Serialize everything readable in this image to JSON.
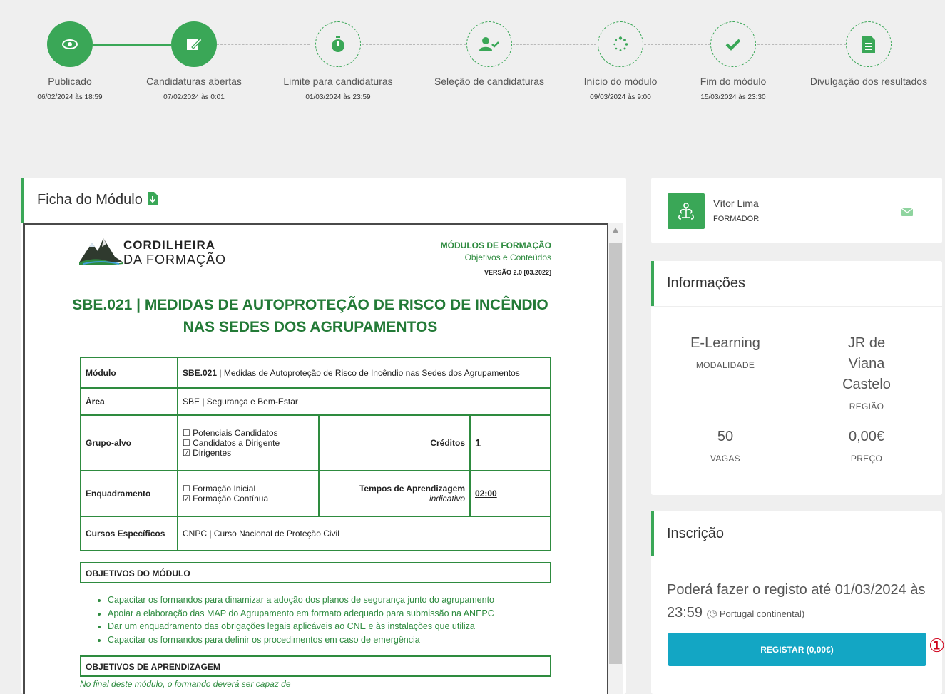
{
  "timeline": {
    "steps": [
      {
        "label": "Publicado",
        "date": "06/02/2024 às 18:59",
        "icon": "eye-icon",
        "state": "done"
      },
      {
        "label": "Candidaturas abertas",
        "date": "07/02/2024 às 0:01",
        "icon": "edit-form-icon",
        "state": "done"
      },
      {
        "label": "Limite para candidaturas",
        "date": "01/03/2024 às 23:59",
        "icon": "stopwatch-icon",
        "state": "todo"
      },
      {
        "label": "Seleção de candidaturas",
        "date": "",
        "icon": "user-check-icon",
        "state": "todo"
      },
      {
        "label": "Início do módulo",
        "date": "09/03/2024 às 9:00",
        "icon": "spinner-icon",
        "state": "todo"
      },
      {
        "label": "Fim do módulo",
        "date": "15/03/2024 às 23:30",
        "icon": "check-icon",
        "state": "todo"
      },
      {
        "label": "Divulgação dos resultados",
        "date": "",
        "icon": "document-icon",
        "state": "todo"
      }
    ]
  },
  "ficha": {
    "title": "Ficha do Módulo",
    "icon": "download-pdf-icon",
    "doc": {
      "logo_line1": "CORDILHEIRA",
      "logo_line2": "DA FORMAÇÃO",
      "header_1": "MÓDULOS DE FORMAÇÃO",
      "header_2": "Objetivos e Conteúdos",
      "version": "VERSÃO 2.0 [03.2022]",
      "title_line1": "SBE.021 | MEDIDAS DE AUTOPROTEÇÃO DE RISCO DE INCÊNDIO",
      "title_line2": "NAS SEDES DOS AGRUPAMENTOS",
      "rows": {
        "modulo_key": "Módulo",
        "modulo_code": "SBE.021",
        "modulo_val": " | Medidas de Autoproteção de Risco de Incêndio nas Sedes dos Agrupamentos",
        "area_key": "Área",
        "area_val": "SBE | Segurança e Bem-Estar",
        "grupo_key": "Grupo-alvo",
        "grupo_opts": [
          "☐ Potenciais Candidatos",
          "☐ Candidatos a Dirigente",
          "☑ Dirigentes"
        ],
        "creditos_key": "Créditos",
        "creditos_val": "1",
        "enq_key": "Enquadramento",
        "enq_opts": [
          "☐ Formação Inicial",
          "☑ Formação Contínua"
        ],
        "tempos_key": "Tempos de Aprendizagem",
        "tempos_note": "indicativo",
        "tempos_val": "02:00",
        "cursos_key": "Cursos Específicos",
        "cursos_val": "CNPC | Curso Nacional de Proteção Civil"
      },
      "objetivos_title": "OBJETIVOS DO MÓDULO",
      "objetivos": [
        "Capacitar os formandos para dinamizar a adoção dos planos de segurança junto do agrupamento",
        "Apoiar a elaboração das MAP do Agrupamento em formato adequado para submissão na ANEPC",
        "Dar um enquadramento das obrigações legais aplicáveis ao CNE e às instalações que utiliza",
        "Capacitar os formandos para definir os procedimentos em caso de emergência"
      ],
      "aprendizagem_title": "OBJETIVOS DE APRENDIZAGEM",
      "aprendizagem_intro": "No final deste módulo, o formando deverá ser capaz de"
    }
  },
  "trainer": {
    "name": "Vítor Lima",
    "role": "FORMADOR"
  },
  "info": {
    "title": "Informações",
    "modalidade_value": "E-Learning",
    "modalidade_label": "MODALIDADE",
    "regiao_value": "JR de Viana Castelo",
    "regiao_label": "REGIÃO",
    "vagas_value": "50",
    "vagas_label": "VAGAS",
    "preco_value": "0,00€",
    "preco_label": "PREÇO"
  },
  "inscricao": {
    "title": "Inscrição",
    "text": "Poderá fazer o registo até 01/03/2024 às 23:59",
    "timezone": "Portugal continental",
    "button": "REGISTAR (0,00€)"
  },
  "marker": "①",
  "colors": {
    "accent": "#3aa757",
    "button": "#13a6c4",
    "doc_green": "#2e8b3f"
  }
}
